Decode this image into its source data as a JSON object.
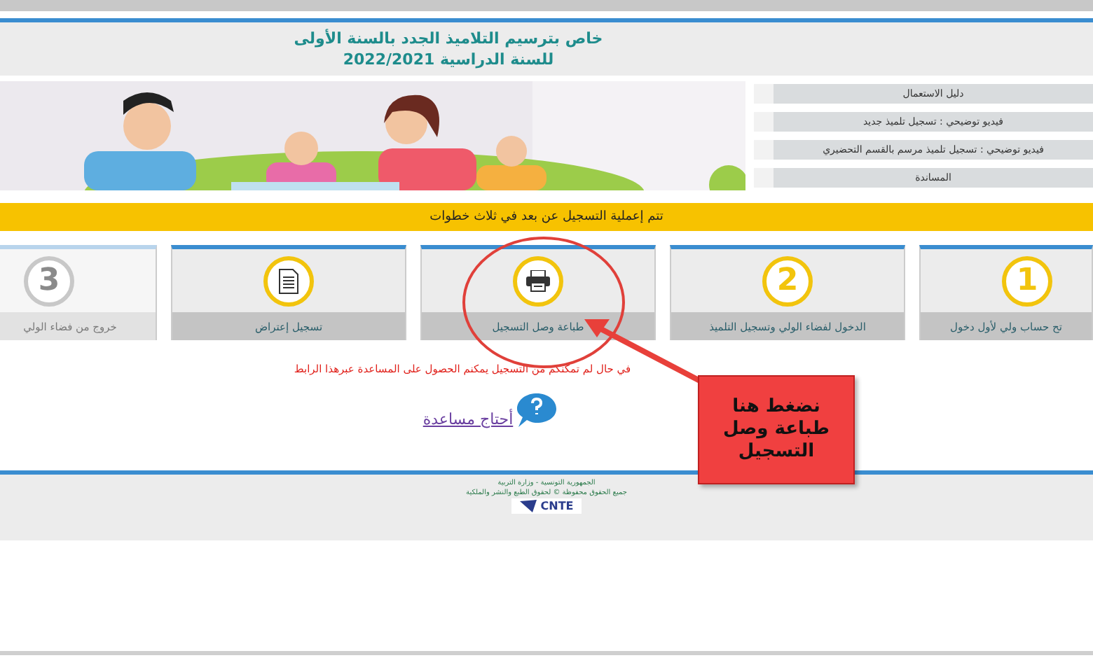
{
  "header": {
    "title": "خاص بترسيم التلاميذ الجدد بالسنة الأولى",
    "subtitle": "للسنة الدراسية 2022/2021"
  },
  "banner": {
    "kind": "picture"
  },
  "side_menu": [
    "دليل الاستعمال",
    "فيديو توضيحي : تسجيل تلميذ جديد",
    "فيديو توضيحي : تسجيل تلميذ مرسم بالقسم التحضيري",
    "المساندة"
  ],
  "notice": "تتم إعملية التسجيل عن بعد في ثلاث خطوات",
  "steps": [
    {
      "kind": "number",
      "number": "1",
      "label": "تح حساب ولي لأول دخول",
      "disabled": false
    },
    {
      "kind": "number",
      "number": "2",
      "label": "الدخول لفضاء الولي وتسجيل التلميذ",
      "disabled": false
    },
    {
      "kind": "printer",
      "label": "طباعة وصل التسجيل",
      "disabled": false
    },
    {
      "kind": "document",
      "label": "تسجيل إعتراض",
      "disabled": false
    },
    {
      "kind": "number",
      "number": "3",
      "label": "خروج من فضاء الولي",
      "disabled": true
    }
  ],
  "help_notice": "في حال لم تمكنكم من التسجيل يمكنم الحصول على المساعدة عبرهذا الرابط",
  "help_link": "أحتاج مساعدة",
  "footer": {
    "lines": [
      "الجمهورية التونسية - وزارة التربية",
      "جميع الحقوق محفوظة © لحقوق الطبع والنشر والملكية"
    ],
    "logo": "CNTE"
  },
  "callout": {
    "lines": [
      "نضغط هنا",
      "طباعة وصل",
      "التسجيل"
    ]
  }
}
